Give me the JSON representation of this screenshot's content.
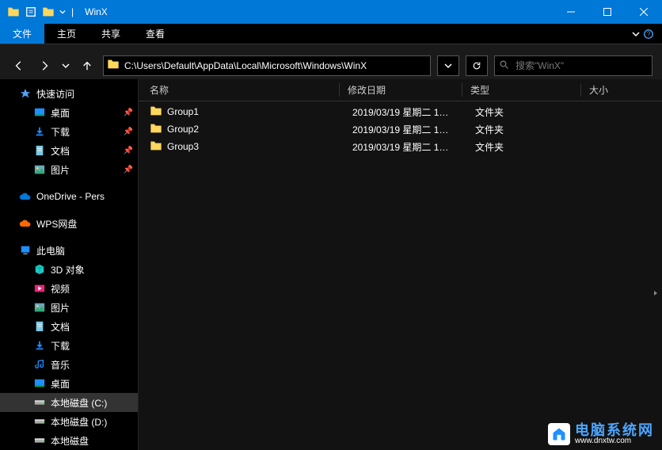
{
  "window": {
    "title": "WinX",
    "separator": "|"
  },
  "menubar": {
    "file": "文件",
    "home": "主页",
    "share": "共享",
    "view": "查看"
  },
  "address": {
    "path": "C:\\Users\\Default\\AppData\\Local\\Microsoft\\Windows\\WinX"
  },
  "search": {
    "placeholder": "搜索\"WinX\""
  },
  "sidebar": {
    "quick_access": "快速访问",
    "quick_items": [
      {
        "label": "桌面",
        "icon": "desktop",
        "pinned": true
      },
      {
        "label": "下载",
        "icon": "download",
        "pinned": true
      },
      {
        "label": "文档",
        "icon": "document",
        "pinned": true
      },
      {
        "label": "图片",
        "icon": "picture",
        "pinned": true
      }
    ],
    "onedrive": "OneDrive - Pers",
    "wps": "WPS网盘",
    "this_pc": "此电脑",
    "pc_items": [
      {
        "label": "3D 对象",
        "icon": "3d"
      },
      {
        "label": "视频",
        "icon": "video"
      },
      {
        "label": "图片",
        "icon": "picture"
      },
      {
        "label": "文档",
        "icon": "document"
      },
      {
        "label": "下载",
        "icon": "download"
      },
      {
        "label": "音乐",
        "icon": "music"
      },
      {
        "label": "桌面",
        "icon": "desktop"
      },
      {
        "label": "本地磁盘 (C:)",
        "icon": "disk",
        "selected": true
      },
      {
        "label": "本地磁盘 (D:)",
        "icon": "disk"
      },
      {
        "label": "本地磁盘",
        "icon": "disk"
      }
    ]
  },
  "columns": {
    "name": "名称",
    "date": "修改日期",
    "type": "类型",
    "size": "大小"
  },
  "files": [
    {
      "name": "Group1",
      "date": "2019/03/19 星期二 1…",
      "type": "文件夹",
      "size": ""
    },
    {
      "name": "Group2",
      "date": "2019/03/19 星期二 1…",
      "type": "文件夹",
      "size": ""
    },
    {
      "name": "Group3",
      "date": "2019/03/19 星期二 1…",
      "type": "文件夹",
      "size": ""
    }
  ],
  "watermark": {
    "cn": "电脑系统网",
    "url": "www.dnxtw.com"
  },
  "colors": {
    "accent": "#0078d7",
    "folder": "#ffd75e"
  }
}
